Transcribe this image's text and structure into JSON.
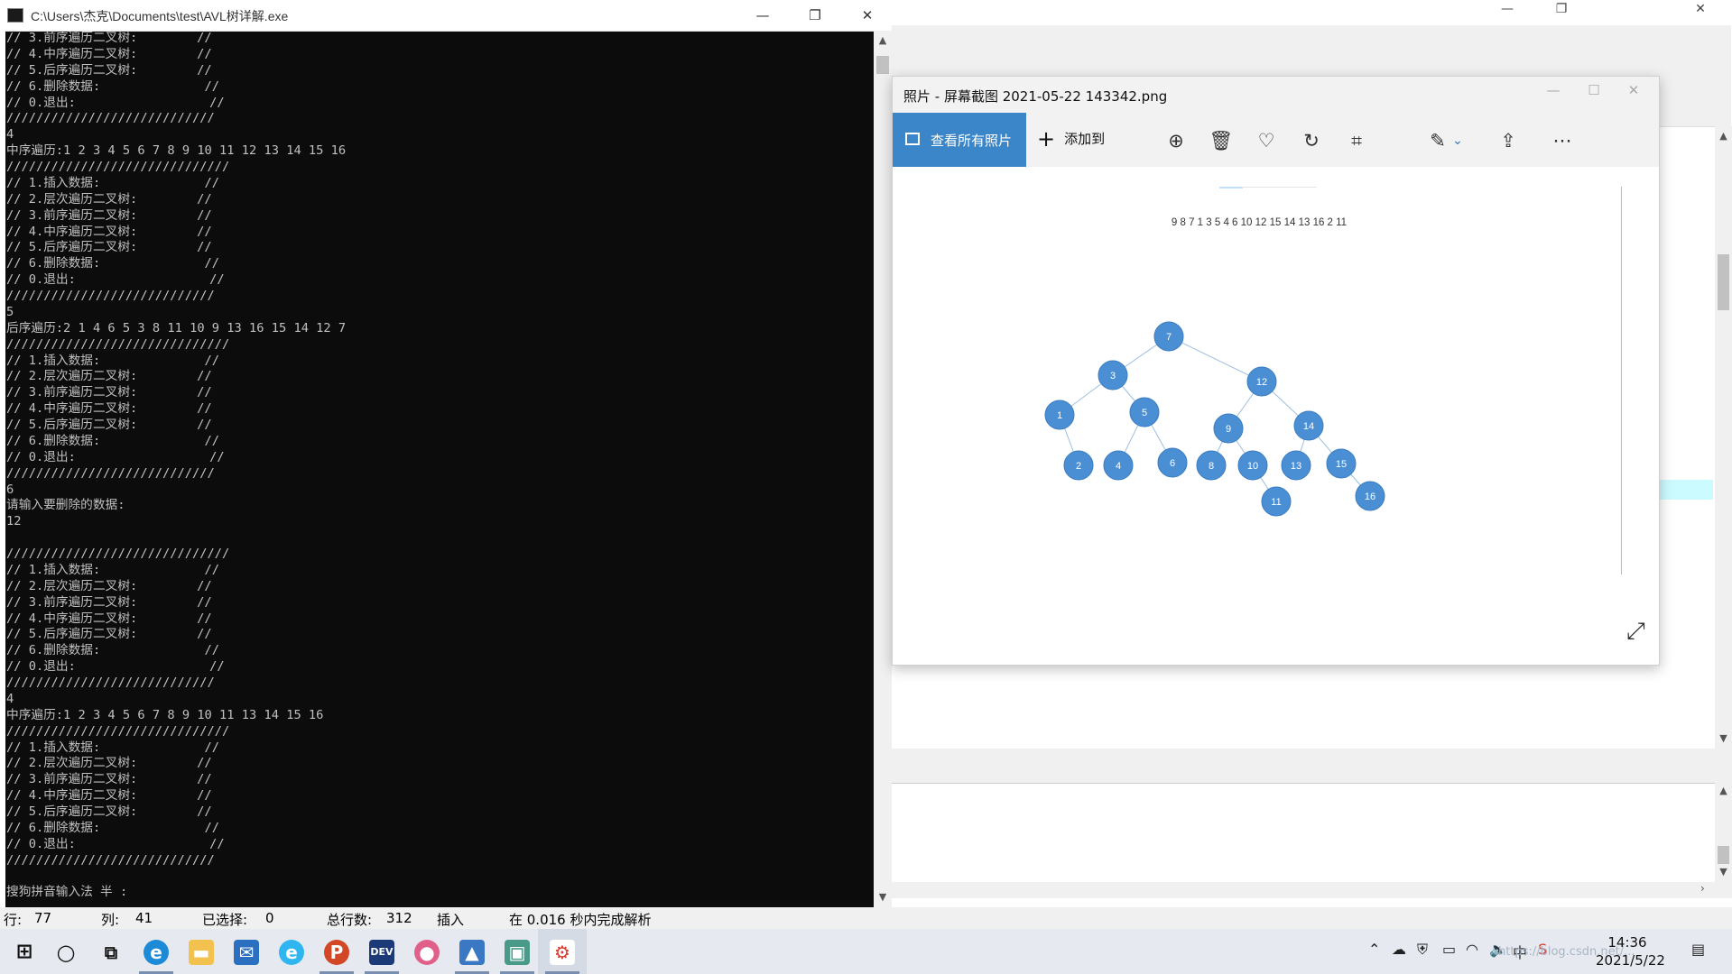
{
  "console": {
    "title": "C:\\Users\\杰克\\Documents\\test\\AVL树详解.exe",
    "lines": [
      "// 3.前序遍历二叉树:        //",
      "// 4.中序遍历二叉树:        //",
      "// 5.后序遍历二叉树:        //",
      "// 6.删除数据:              //",
      "// 0.退出:                  //",
      "////////////////////////////",
      "4",
      "中序遍历:1 2 3 4 5 6 7 8 9 10 11 12 13 14 15 16",
      "//////////////////////////////",
      "// 1.插入数据:              //",
      "// 2.层次遍历二叉树:        //",
      "// 3.前序遍历二叉树:        //",
      "// 4.中序遍历二叉树:        //",
      "// 5.后序遍历二叉树:        //",
      "// 6.删除数据:              //",
      "// 0.退出:                  //",
      "////////////////////////////",
      "5",
      "后序遍历:2 1 4 6 5 3 8 11 10 9 13 16 15 14 12 7",
      "//////////////////////////////",
      "// 1.插入数据:              //",
      "// 2.层次遍历二叉树:        //",
      "// 3.前序遍历二叉树:        //",
      "// 4.中序遍历二叉树:        //",
      "// 5.后序遍历二叉树:        //",
      "// 6.删除数据:              //",
      "// 0.退出:                  //",
      "////////////////////////////",
      "6",
      "请输入要删除的数据:",
      "12",
      "",
      "//////////////////////////////",
      "// 1.插入数据:              //",
      "// 2.层次遍历二叉树:        //",
      "// 3.前序遍历二叉树:        //",
      "// 4.中序遍历二叉树:        //",
      "// 5.后序遍历二叉树:        //",
      "// 6.删除数据:              //",
      "// 0.退出:                  //",
      "////////////////////////////",
      "4",
      "中序遍历:1 2 3 4 5 6 7 8 9 10 11 13 14 15 16",
      "//////////////////////////////",
      "// 1.插入数据:              //",
      "// 2.层次遍历二叉树:        //",
      "// 3.前序遍历二叉树:        //",
      "// 4.中序遍历二叉树:        //",
      "// 5.后序遍历二叉树:        //",
      "// 6.删除数据:              //",
      "// 0.退出:                  //",
      "////////////////////////////",
      "",
      "搜狗拼音输入法 半 :"
    ]
  },
  "status": {
    "row_label": "行:",
    "row_value": "77",
    "col_label": "列:",
    "col_value": "41",
    "selected_label": "已选择:",
    "selected_value": "0",
    "total_label": "总行数:",
    "total_value": "312",
    "mode": "插入",
    "parse": "在 0.016 秒内完成解析"
  },
  "photos": {
    "title": "照片 - 屏幕截图 2021-05-22 143342.png",
    "view_all": "查看所有照片",
    "add_to": "添加到",
    "sequence": "9 8 7 1 3 5 4 6  10 12  15 14 13 16 2 11",
    "tree": {
      "nodes": [
        {
          "id": "7",
          "color": "#4a8fd4"
        },
        {
          "id": "3"
        },
        {
          "id": "12"
        },
        {
          "id": "1"
        },
        {
          "id": "5"
        },
        {
          "id": "9"
        },
        {
          "id": "14"
        },
        {
          "id": "2"
        },
        {
          "id": "4"
        },
        {
          "id": "6"
        },
        {
          "id": "8"
        },
        {
          "id": "10"
        },
        {
          "id": "13"
        },
        {
          "id": "15"
        },
        {
          "id": "11"
        },
        {
          "id": "16"
        }
      ],
      "edges": [
        [
          "7",
          "3"
        ],
        [
          "7",
          "12"
        ],
        [
          "3",
          "1"
        ],
        [
          "3",
          "5"
        ],
        [
          "1",
          "2"
        ],
        [
          "5",
          "4"
        ],
        [
          "5",
          "6"
        ],
        [
          "12",
          "9"
        ],
        [
          "12",
          "14"
        ],
        [
          "9",
          "8"
        ],
        [
          "9",
          "10"
        ],
        [
          "10",
          "11"
        ],
        [
          "14",
          "13"
        ],
        [
          "14",
          "15"
        ],
        [
          "15",
          "16"
        ]
      ]
    }
  },
  "taskbar": {
    "time": "14:36",
    "date": "2021/5/22",
    "watermark": "https://blog.csdn.net/...",
    "apps": [
      "start",
      "search",
      "task-view",
      "edge",
      "file-explorer",
      "mail",
      "edge-beta",
      "powerpoint",
      "dev-cpp",
      "paint",
      "photos",
      "app",
      "console-app"
    ]
  },
  "colors": {
    "accent": "#3b86c9",
    "node_fill": "#4a8fd4",
    "console_bg": "#0c0c0c",
    "console_text": "#c0c0c0"
  }
}
